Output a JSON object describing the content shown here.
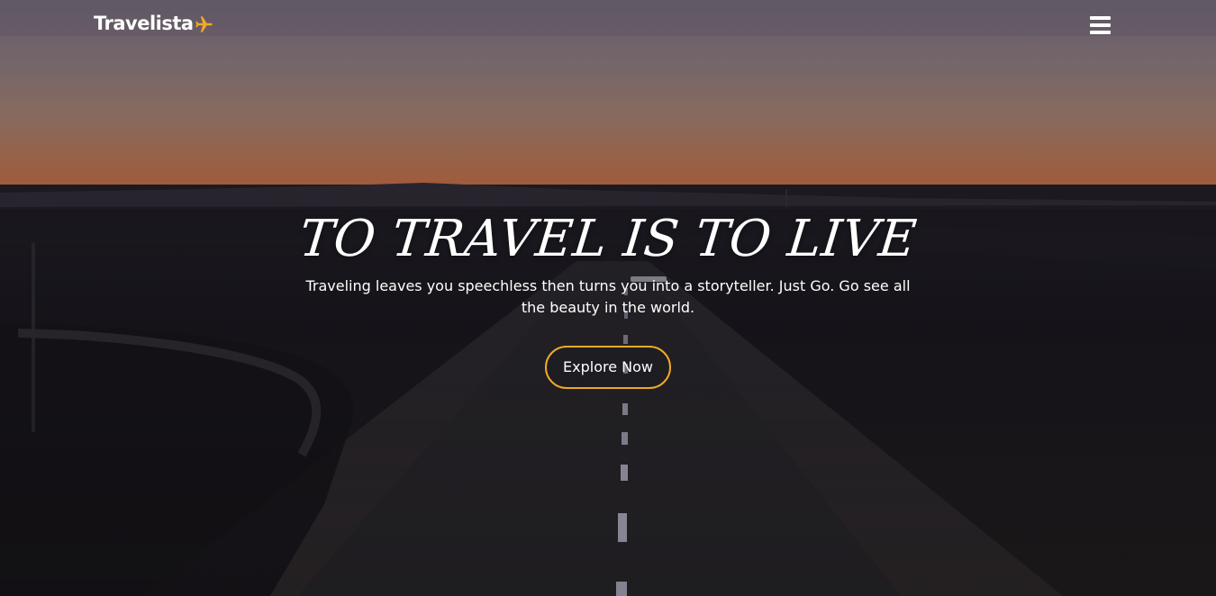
{
  "brand": {
    "name": "Travelista",
    "icon": "airplane-icon",
    "icon_color": "#f0a828"
  },
  "nav": {
    "menu_icon": "hamburger-menu-icon"
  },
  "hero": {
    "headline": "TO TRAVEL IS TO LIVE",
    "subtitle": "Traveling leaves you speechless then turns you into a storyteller. Just Go. Go see all the beauty in the world.",
    "cta_label": "Explore Now",
    "cta_border_color": "#f0a828",
    "background": "dusk-highway-landscape"
  }
}
